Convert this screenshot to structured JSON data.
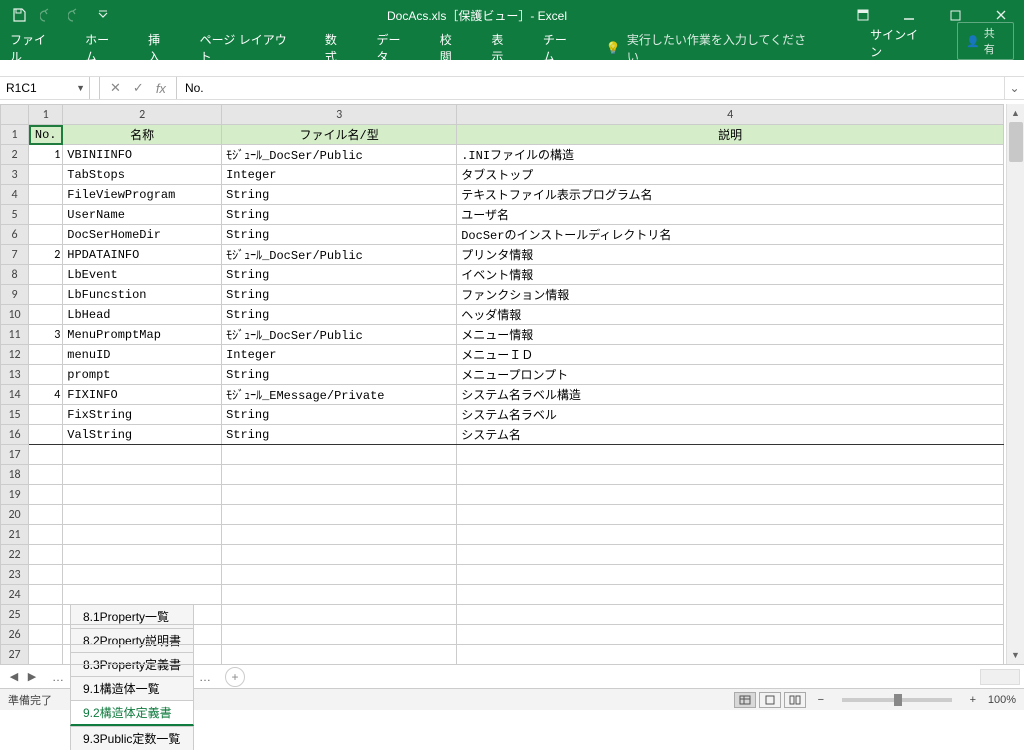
{
  "title": "DocAcs.xls［保護ビュー］- Excel",
  "ribbon": {
    "tabs": [
      "ファイル",
      "ホーム",
      "挿入",
      "ページ レイアウト",
      "数式",
      "データ",
      "校閲",
      "表示",
      "チーム"
    ],
    "tell_me": "実行したい作業を入力してください",
    "signin": "サインイン",
    "share": "共有"
  },
  "formula_bar": {
    "name_box": "R1C1",
    "fx_label": "fx",
    "value": "No."
  },
  "grid": {
    "col_headers": [
      "1",
      "2",
      "3",
      "4"
    ],
    "header_row": {
      "no": "No.",
      "name": "名称",
      "file_type": "ファイル名/型",
      "desc": "説明"
    },
    "rows": [
      {
        "no": "1",
        "name": "VBINIINFO",
        "file_type": "ﾓｼﾞｭｰﾙ_DocSer/Public",
        "desc": ".INIファイルの構造",
        "group_top": true
      },
      {
        "no": "",
        "name": "TabStops",
        "file_type": "Integer",
        "desc": "タブストップ"
      },
      {
        "no": "",
        "name": "FileViewProgram",
        "file_type": "String",
        "desc": "テキストファイル表示プログラム名"
      },
      {
        "no": "",
        "name": "UserName",
        "file_type": "String",
        "desc": "ユーザ名"
      },
      {
        "no": "",
        "name": "DocSerHomeDir",
        "file_type": "String",
        "desc": "DocSerのインストールディレクトリ名"
      },
      {
        "no": "2",
        "name": "HPDATAINFO",
        "file_type": "ﾓｼﾞｭｰﾙ_DocSer/Public",
        "desc": "プリンタ情報",
        "group_top": true
      },
      {
        "no": "",
        "name": "LbEvent",
        "file_type": "String",
        "desc": "イベント情報"
      },
      {
        "no": "",
        "name": "LbFuncstion",
        "file_type": "String",
        "desc": "ファンクション情報"
      },
      {
        "no": "",
        "name": "LbHead",
        "file_type": "String",
        "desc": "ヘッダ情報"
      },
      {
        "no": "3",
        "name": "MenuPromptMap",
        "file_type": "ﾓｼﾞｭｰﾙ_DocSer/Public",
        "desc": "メニュー情報",
        "group_top": true
      },
      {
        "no": "",
        "name": "menuID",
        "file_type": "Integer",
        "desc": "メニューＩＤ"
      },
      {
        "no": "",
        "name": "prompt",
        "file_type": "String",
        "desc": "メニュープロンプト"
      },
      {
        "no": "4",
        "name": "FIXINFO",
        "file_type": "ﾓｼﾞｭｰﾙ_EMessage/Private",
        "desc": "システム名ラベル構造",
        "group_top": true
      },
      {
        "no": "",
        "name": "FixString",
        "file_type": "String",
        "desc": "システム名ラベル"
      },
      {
        "no": "",
        "name": "ValString",
        "file_type": "String",
        "desc": "システム名",
        "last_data": true
      }
    ],
    "empty_rows_after": 11,
    "first_row_num": 1
  },
  "sheet_tabs": {
    "tabs": [
      "8.1Property一覧",
      "8.2Property説明書",
      "8.3Property定義書",
      "9.1構造体一覧",
      "9.2構造体定義書",
      "9.3Public定数一覧"
    ],
    "active": 4
  },
  "status": {
    "ready": "準備完了",
    "zoom": "100%"
  }
}
